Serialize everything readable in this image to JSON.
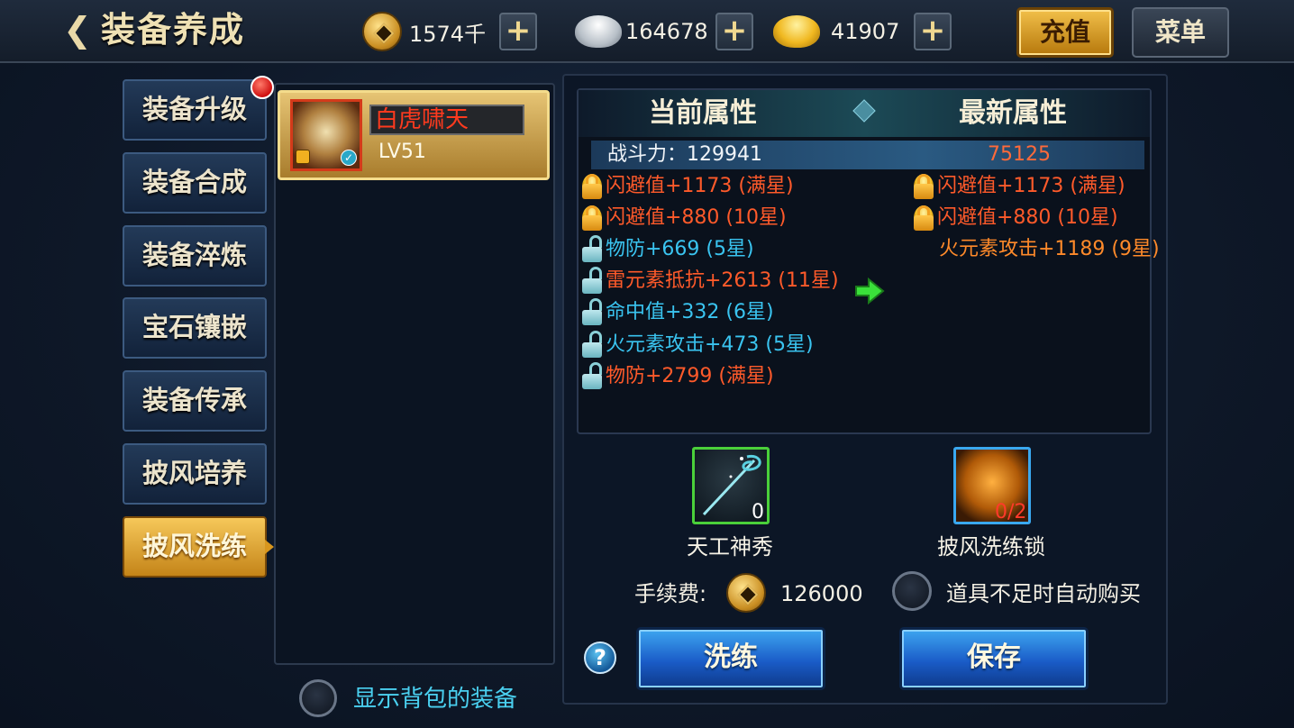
{
  "header": {
    "title": "装备养成",
    "copper": "1574千",
    "silver": "164678",
    "gold": "41907",
    "plus_label": "+",
    "recharge_label": "充值",
    "menu_label": "菜单"
  },
  "tabs": [
    {
      "label": "装备升级"
    },
    {
      "label": "装备合成"
    },
    {
      "label": "装备淬炼"
    },
    {
      "label": "宝石镶嵌"
    },
    {
      "label": "装备传承"
    },
    {
      "label": "披风培养"
    },
    {
      "label": "披风洗练"
    }
  ],
  "equipment": {
    "name": "白虎啸天",
    "level": "LV51",
    "show_bag_label": "显示背包的装备"
  },
  "attributes": {
    "current_header": "当前属性",
    "new_header": "最新属性",
    "power_label": "战斗力：129941",
    "power_new": "75125",
    "current": [
      {
        "text": "闪避值+1173 (满星)",
        "lock": "locked",
        "color": "#ff5a2a"
      },
      {
        "text": "闪避值+880 (10星)",
        "lock": "locked",
        "color": "#ff5a2a"
      },
      {
        "text": "物防+669 (5星)",
        "lock": "unlocked",
        "color": "#3ac4f0"
      },
      {
        "text": "雷元素抵抗+2613 (11星)",
        "lock": "unlocked",
        "color": "#ff5a2a"
      },
      {
        "text": "命中值+332 (6星)",
        "lock": "unlocked",
        "color": "#3ac4f0"
      },
      {
        "text": "火元素攻击+473 (5星)",
        "lock": "unlocked",
        "color": "#3ac4f0"
      },
      {
        "text": "物防+2799 (满星)",
        "lock": "unlocked",
        "color": "#ff5a2a"
      }
    ],
    "new": [
      {
        "text": "闪避值+1173 (满星)",
        "lock": "locked",
        "color": "#ff5a2a"
      },
      {
        "text": "闪避值+880 (10星)",
        "lock": "locked",
        "color": "#ff5a2a"
      },
      {
        "text": "火元素攻击+1189 (9星)",
        "lock": "none",
        "color": "#ff8a2a"
      }
    ]
  },
  "items": [
    {
      "name": "天工神秀",
      "count": "0",
      "icon": "needle-icon"
    },
    {
      "name": "披风洗练锁",
      "count": "0/2",
      "icon": "lock-orb-icon"
    }
  ],
  "fee": {
    "label": "手续费:",
    "value": "126000",
    "auto_buy_label": "道具不足时自动购买"
  },
  "actions": {
    "help_label": "?",
    "refine_label": "洗练",
    "save_label": "保存"
  }
}
